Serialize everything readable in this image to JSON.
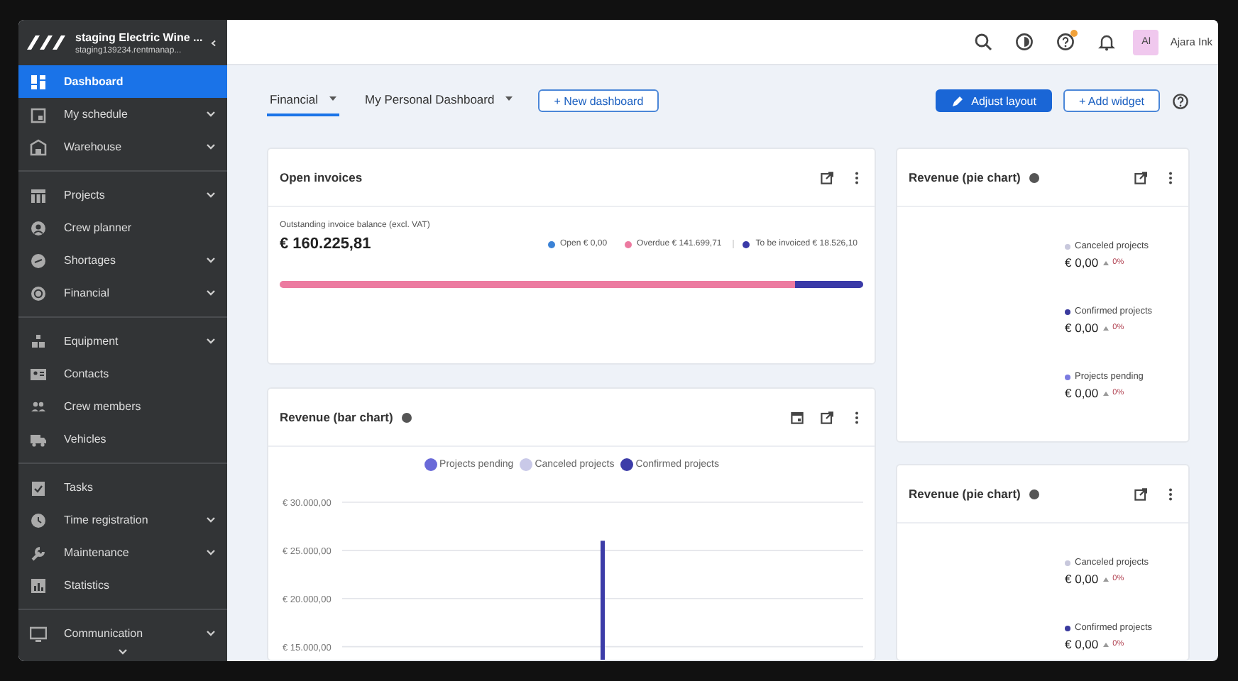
{
  "sidebar": {
    "workspace": "staging Electric Wine ...",
    "url": "staging139234.rentmanap...",
    "groups": [
      [
        {
          "label": "Dashboard",
          "selected": true,
          "has_submenu": false
        },
        {
          "label": "My schedule",
          "selected": false,
          "has_submenu": true
        },
        {
          "label": "Warehouse",
          "selected": false,
          "has_submenu": true
        }
      ],
      [
        {
          "label": "Projects",
          "selected": false,
          "has_submenu": true
        },
        {
          "label": "Crew planner",
          "selected": false,
          "has_submenu": false
        },
        {
          "label": "Shortages",
          "selected": false,
          "has_submenu": true
        },
        {
          "label": "Financial",
          "selected": false,
          "has_submenu": true
        }
      ],
      [
        {
          "label": "Equipment",
          "selected": false,
          "has_submenu": true
        },
        {
          "label": "Contacts",
          "selected": false,
          "has_submenu": false
        },
        {
          "label": "Crew members",
          "selected": false,
          "has_submenu": false
        },
        {
          "label": "Vehicles",
          "selected": false,
          "has_submenu": false
        }
      ],
      [
        {
          "label": "Tasks",
          "selected": false,
          "has_submenu": false
        },
        {
          "label": "Time registration",
          "selected": false,
          "has_submenu": true
        },
        {
          "label": "Maintenance",
          "selected": false,
          "has_submenu": true
        },
        {
          "label": "Statistics",
          "selected": false,
          "has_submenu": false
        }
      ],
      [
        {
          "label": "Communication",
          "selected": false,
          "has_submenu": true
        }
      ]
    ]
  },
  "topbar": {
    "help_badge": true,
    "avatar": "AI",
    "user": "Ajara Ink"
  },
  "tabs": [
    {
      "label": "Financial",
      "selected": true
    },
    {
      "label": "My Personal Dashboard",
      "selected": false
    }
  ],
  "buttons": {
    "new_dashboard": "+ New dashboard",
    "adjust_layout": "Adjust layout",
    "add_widget": "+ Add widget"
  },
  "open_invoices": {
    "title": "Open invoices",
    "caption": "Outstanding invoice balance (excl. VAT)",
    "total": "€ 160.225,81",
    "segments": [
      {
        "label": "Open € 0,00",
        "color": "#3b82d6"
      },
      {
        "label": "Overdue € 141.699,71",
        "color": "#ec7aa0",
        "level": 0.884
      },
      {
        "label": "To be invoiced € 18.526,10",
        "color": "#3a3aa8",
        "level": 0.116
      }
    ]
  },
  "bar_card": {
    "title": "Revenue (bar chart)",
    "chart_data": {
      "type": "bar",
      "ylim": [
        13500,
        30000
      ],
      "grid": true,
      "yticks": [
        {
          "value": 15000,
          "label": "€ 15.000,00"
        },
        {
          "value": 20000,
          "label": "€ 20.000,00"
        },
        {
          "value": 25000,
          "label": "€ 25.000,00"
        },
        {
          "value": 30000,
          "label": "€ 30.000,00"
        }
      ],
      "series": [
        {
          "name": "Projects pending",
          "color": "#6a6ad8",
          "values": [
            null
          ]
        },
        {
          "name": "Canceled projects",
          "color": "#c9c9e8",
          "values": [
            null
          ]
        },
        {
          "name": "Confirmed projects",
          "color": "#3c3ca8",
          "values": [
            26000
          ]
        }
      ]
    }
  },
  "pie_cards": [
    {
      "title": "Revenue (pie chart)",
      "legend": [
        {
          "label": "Canceled projects",
          "color": "#c8c8dc",
          "amount": "€ 0,00",
          "change": "0%"
        },
        {
          "label": "Confirmed projects",
          "color": "#3a3a9e",
          "amount": "€ 0,00",
          "change": "0%"
        },
        {
          "label": "Projects pending",
          "color": "#7b7be0",
          "amount": "€ 0,00",
          "change": "0%"
        }
      ]
    },
    {
      "title": "Revenue (pie chart)",
      "legend": [
        {
          "label": "Canceled projects",
          "color": "#c8c8dc",
          "amount": "€ 0,00",
          "change": "0%"
        },
        {
          "label": "Confirmed projects",
          "color": "#3a3a9e",
          "amount": "€ 0,00",
          "change": "0%"
        }
      ]
    }
  ]
}
